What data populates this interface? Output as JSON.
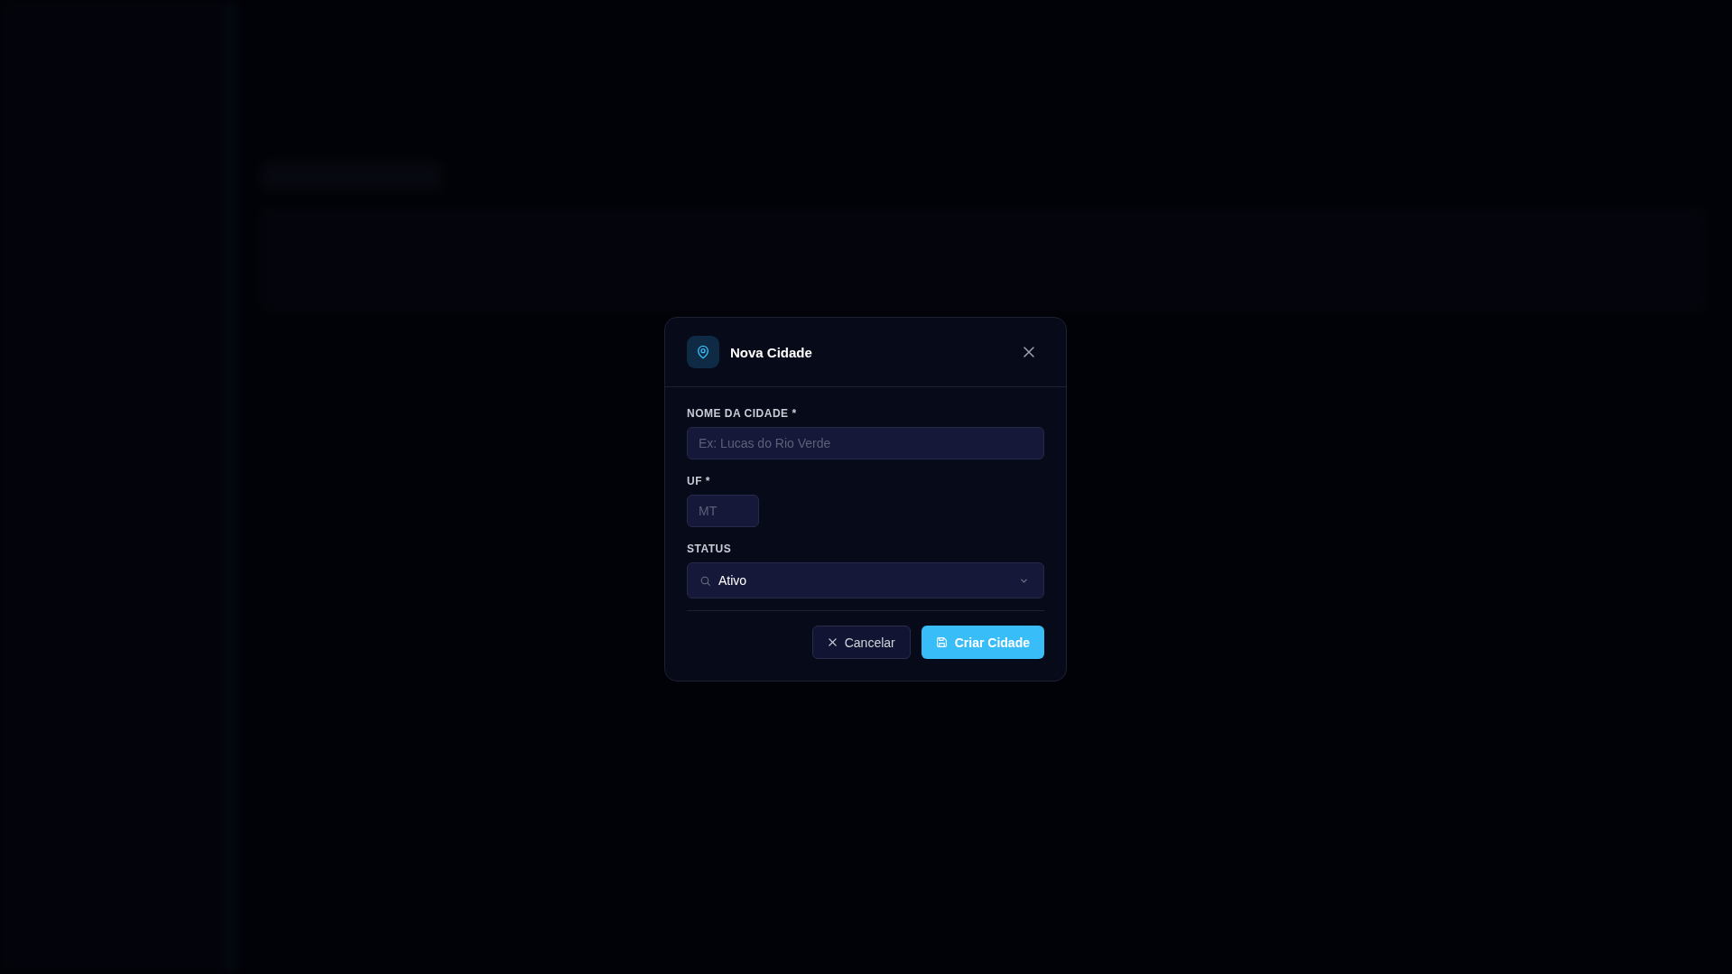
{
  "dialog": {
    "title": "Nova Cidade",
    "fields": [
      {
        "kind": "text",
        "label": "NOME DA CIDADE *",
        "placeholder": "Ex: Lucas do Rio Verde"
      },
      {
        "kind": "short",
        "label": "UF *",
        "placeholder": "MT"
      },
      {
        "kind": "select",
        "label": "STATUS",
        "value": "Ativo"
      }
    ],
    "buttons": [
      {
        "kind": "cancel",
        "label": "Cancelar"
      },
      {
        "kind": "submit",
        "label": "Criar Cidade"
      }
    ]
  }
}
